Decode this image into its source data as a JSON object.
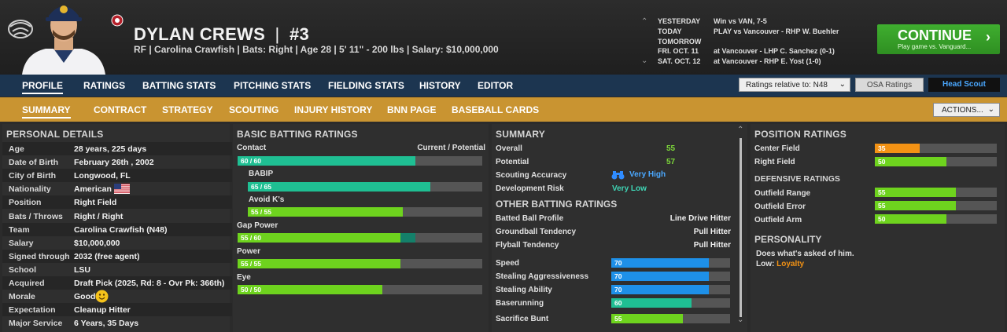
{
  "player": {
    "name": "DYLAN CREWS",
    "number_sep": "|",
    "number": "#3",
    "meta": "RF | Carolina Crawfish   |  Bats: Right   |  Age 28   |  5' 11\" - 200 lbs   |  Salary: $10,000,000"
  },
  "schedule": [
    {
      "day": "YESTERDAY",
      "game": "Win vs VAN, 7-5"
    },
    {
      "day": "TODAY",
      "game": "PLAY vs Vancouver - RHP W. Buehler"
    },
    {
      "day": "TOMORROW",
      "game": ""
    },
    {
      "day": "FRI. OCT. 11",
      "game": "at Vancouver - LHP C. Sanchez (0-1)"
    },
    {
      "day": "SAT. OCT. 12",
      "game": "at Vancouver - RHP E. Yost (1-0)"
    }
  ],
  "continue_button": {
    "label": "CONTINUE",
    "sub": "Play game vs. Vanguard..."
  },
  "nav_primary": [
    "PROFILE",
    "RATINGS",
    "BATTING STATS",
    "PITCHING STATS",
    "FIELDING STATS",
    "HISTORY",
    "EDITOR"
  ],
  "ratings_select": "Ratings relative to: N48",
  "osa_ratings": "OSA Ratings",
  "head_scout": "Head Scout",
  "nav_secondary": [
    "SUMMARY",
    "CONTRACT",
    "STRATEGY",
    "SCOUTING",
    "INJURY HISTORY",
    "BNN PAGE",
    "BASEBALL CARDS"
  ],
  "actions": "ACTIONS...",
  "personal_details": {
    "title": "PERSONAL DETAILS",
    "rows": [
      {
        "label": "Age",
        "value": "28 years, 225 days"
      },
      {
        "label": "Date of Birth",
        "value": "February 26th , 2002"
      },
      {
        "label": "City of Birth",
        "value": "Longwood, FL"
      },
      {
        "label": "Nationality",
        "value": "American"
      },
      {
        "label": "Position",
        "value": "Right Field"
      },
      {
        "label": "Bats / Throws",
        "value": "Right / Right"
      },
      {
        "label": "Team",
        "value": "Carolina Crawfish (N48)"
      },
      {
        "label": "Salary",
        "value": "$10,000,000"
      },
      {
        "label": "Signed through",
        "value": "2032 (free agent)"
      },
      {
        "label": "School",
        "value": "LSU"
      },
      {
        "label": "Acquired",
        "value": "Draft Pick (2025, Rd: 8 - Ovr Pk: 366th)"
      },
      {
        "label": "Morale",
        "value": "Good"
      },
      {
        "label": "Expectation",
        "value": "Cleanup Hitter"
      },
      {
        "label": "Major Service",
        "value": "6 Years, 35 Days"
      }
    ]
  },
  "batting": {
    "title": "BASIC BATTING RATINGS",
    "header": "Current / Potential",
    "ratings": [
      {
        "name": "Contact",
        "text": "60 / 60",
        "current": 60,
        "potential": 60,
        "color": "#1fbf93"
      },
      {
        "name": "BABIP",
        "text": "65 / 65",
        "current": 65,
        "potential": 65,
        "color": "#1fbf93"
      },
      {
        "name": "Avoid K's",
        "text": "55 / 55",
        "current": 55,
        "potential": 55,
        "color": "#6ed31e"
      },
      {
        "name": "Gap Power",
        "text": "55 / 60",
        "current": 55,
        "potential": 60,
        "color": "#6ed31e"
      },
      {
        "name": "Power",
        "text": "55 / 55",
        "current": 55,
        "potential": 55,
        "color": "#6ed31e"
      },
      {
        "name": "Eye",
        "text": "50 / 50",
        "current": 50,
        "potential": 50,
        "color": "#6ed31e"
      }
    ]
  },
  "summary": {
    "title": "SUMMARY",
    "overall_label": "Overall",
    "overall": "55",
    "potential_label": "Potential",
    "potential": "57",
    "accuracy_label": "Scouting Accuracy",
    "accuracy": "Very High",
    "risk_label": "Development Risk",
    "risk": "Very Low"
  },
  "other_batting": {
    "title": "OTHER BATTING RATINGS",
    "text_rows": [
      {
        "label": "Batted Ball Profile",
        "value": "Line Drive Hitter"
      },
      {
        "label": "Groundball Tendency",
        "value": "Pull Hitter"
      },
      {
        "label": "Flyball Tendency",
        "value": "Pull Hitter"
      }
    ],
    "bars": [
      {
        "label": "Speed",
        "value": 70,
        "color": "#1e90e8"
      },
      {
        "label": "Stealing Aggressiveness",
        "value": 70,
        "color": "#1e90e8"
      },
      {
        "label": "Stealing Ability",
        "value": 70,
        "color": "#1e90e8"
      },
      {
        "label": "Baserunning",
        "value": 60,
        "color": "#1fbf93"
      },
      {
        "label": "Sacrifice Bunt",
        "value": 55,
        "color": "#6ed31e"
      }
    ]
  },
  "position_ratings": {
    "title": "POSITION RATINGS",
    "rows": [
      {
        "label": "Center Field",
        "value": 35,
        "color": "#f39214"
      },
      {
        "label": "Right Field",
        "value": 50,
        "color": "#6ed31e"
      }
    ]
  },
  "defensive_ratings": {
    "title": "DEFENSIVE RATINGS",
    "rows": [
      {
        "label": "Outfield Range",
        "value": 55,
        "color": "#6ed31e"
      },
      {
        "label": "Outfield Error",
        "value": 55,
        "color": "#6ed31e"
      },
      {
        "label": "Outfield Arm",
        "value": 50,
        "color": "#6ed31e"
      }
    ]
  },
  "personality": {
    "title": "PERSONALITY",
    "line1": "Does what's asked of him.",
    "low_label": "Low:",
    "low_value": "Loyalty"
  }
}
